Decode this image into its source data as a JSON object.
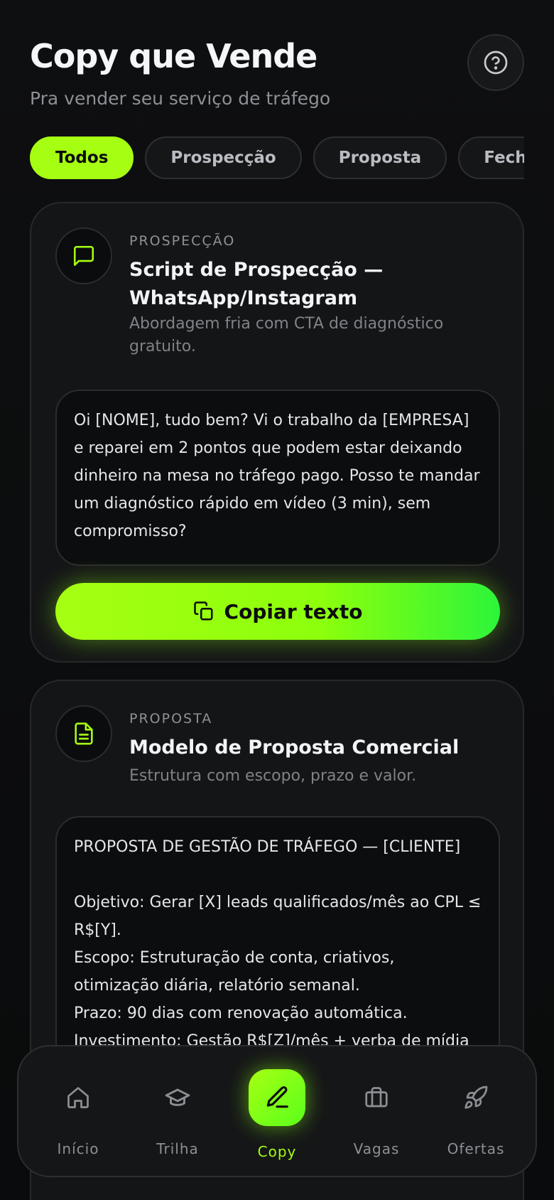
{
  "header": {
    "title": "Copy que Vende",
    "subtitle": "Pra vender seu serviço de tráfego",
    "help_icon": "question-circle-icon"
  },
  "filters": [
    "Todos",
    "Prospecção",
    "Proposta",
    "Fechamento"
  ],
  "active_filter": "Todos",
  "cards": [
    {
      "category": "PROSPECÇÃO",
      "icon": "message-square-icon",
      "title": "Script de Prospecção — WhatsApp/Instagram",
      "description": "Abordagem fria com CTA de diagnóstico gratuito.",
      "text": "Oi [NOME], tudo bem? Vi o trabalho da [EMPRESA] e reparei em 2 pontos que podem estar deixando dinheiro na mesa no tráfego pago. Posso te mandar um diagnóstico rápido em vídeo (3 min), sem compromisso?",
      "button_label": "Copiar texto"
    },
    {
      "category": "PROPOSTA",
      "icon": "document-icon",
      "title": "Modelo de Proposta Comercial",
      "description": "Estrutura com escopo, prazo e valor.",
      "text": "PROPOSTA DE GESTÃO DE TRÁFEGO — [CLIENTE]\n\nObjetivo: Gerar [X] leads qualificados/mês ao CPL ≤ R$[Y].\nEscopo: Estruturação de conta, criativos, otimização diária, relatório semanal.\nPrazo: 90 dias com renovação automática.\nInvestimento: Gestão R$[Z]/mês + verba de mídia"
    }
  ],
  "nav": {
    "items": [
      {
        "label": "Início",
        "icon": "home-icon"
      },
      {
        "label": "Trilha",
        "icon": "graduation-cap-icon"
      },
      {
        "label": "Copy",
        "icon": "pen-icon"
      },
      {
        "label": "Vagas",
        "icon": "briefcase-icon"
      },
      {
        "label": "Ofertas",
        "icon": "rocket-icon"
      }
    ],
    "active": "Copy"
  },
  "colors": {
    "accent": "#a6ff12",
    "background": "#0b0c0d",
    "card": "#141517"
  }
}
